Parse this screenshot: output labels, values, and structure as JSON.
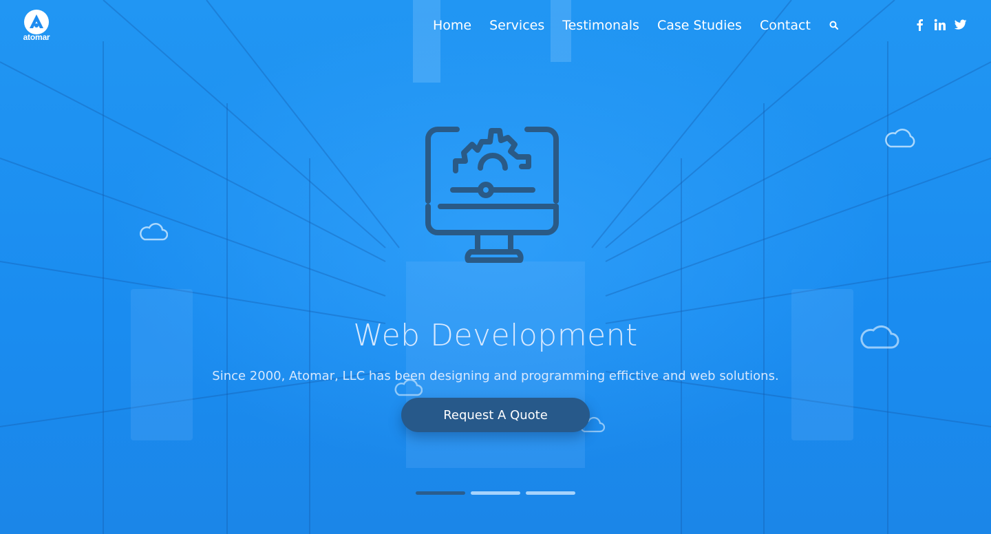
{
  "brand": {
    "name": "atomar",
    "icon": "atomar-logo-icon"
  },
  "nav": {
    "items": [
      {
        "label": "Home"
      },
      {
        "label": "Services"
      },
      {
        "label": "Testimonals"
      },
      {
        "label": "Case Studies"
      },
      {
        "label": "Contact"
      }
    ],
    "search_icon": "search-icon"
  },
  "social": [
    {
      "icon": "facebook-icon"
    },
    {
      "icon": "linkedin-icon"
    },
    {
      "icon": "twitter-icon"
    }
  ],
  "hero": {
    "icon": "monitor-gear-icon",
    "title": "Web Development",
    "subtitle": "Since 2000, Atomar, LLC has been designing and programming effictive and web solutions.",
    "cta_label": "Request A Quote"
  },
  "slider": {
    "count": 3,
    "active": 1
  },
  "colors": {
    "background": "#1e8cf0",
    "button": "#27598a",
    "icon_stroke": "#2a5a86",
    "active_dot": "#2a5d8e"
  }
}
